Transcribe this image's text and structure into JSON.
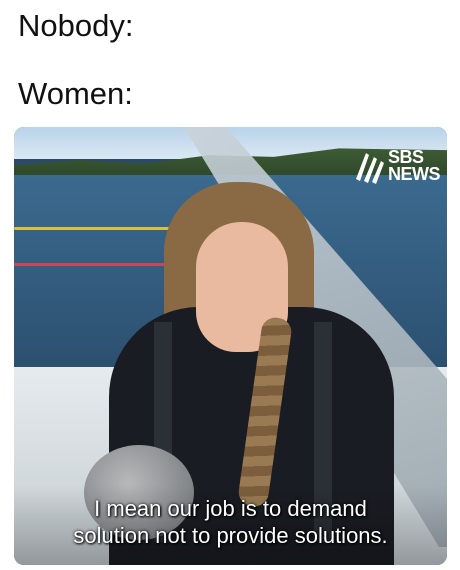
{
  "meme": {
    "line1": "Nobody:",
    "line2": "Women:"
  },
  "video": {
    "logo_text_top": "SBS",
    "logo_text_bottom": "NEWS",
    "subtitle_line1": "I mean our job is to demand",
    "subtitle_line2": "solution not to provide solutions."
  },
  "colors": {
    "logo": "#ffffff",
    "subtitle": "#ffffff",
    "background": "#ffffff"
  }
}
